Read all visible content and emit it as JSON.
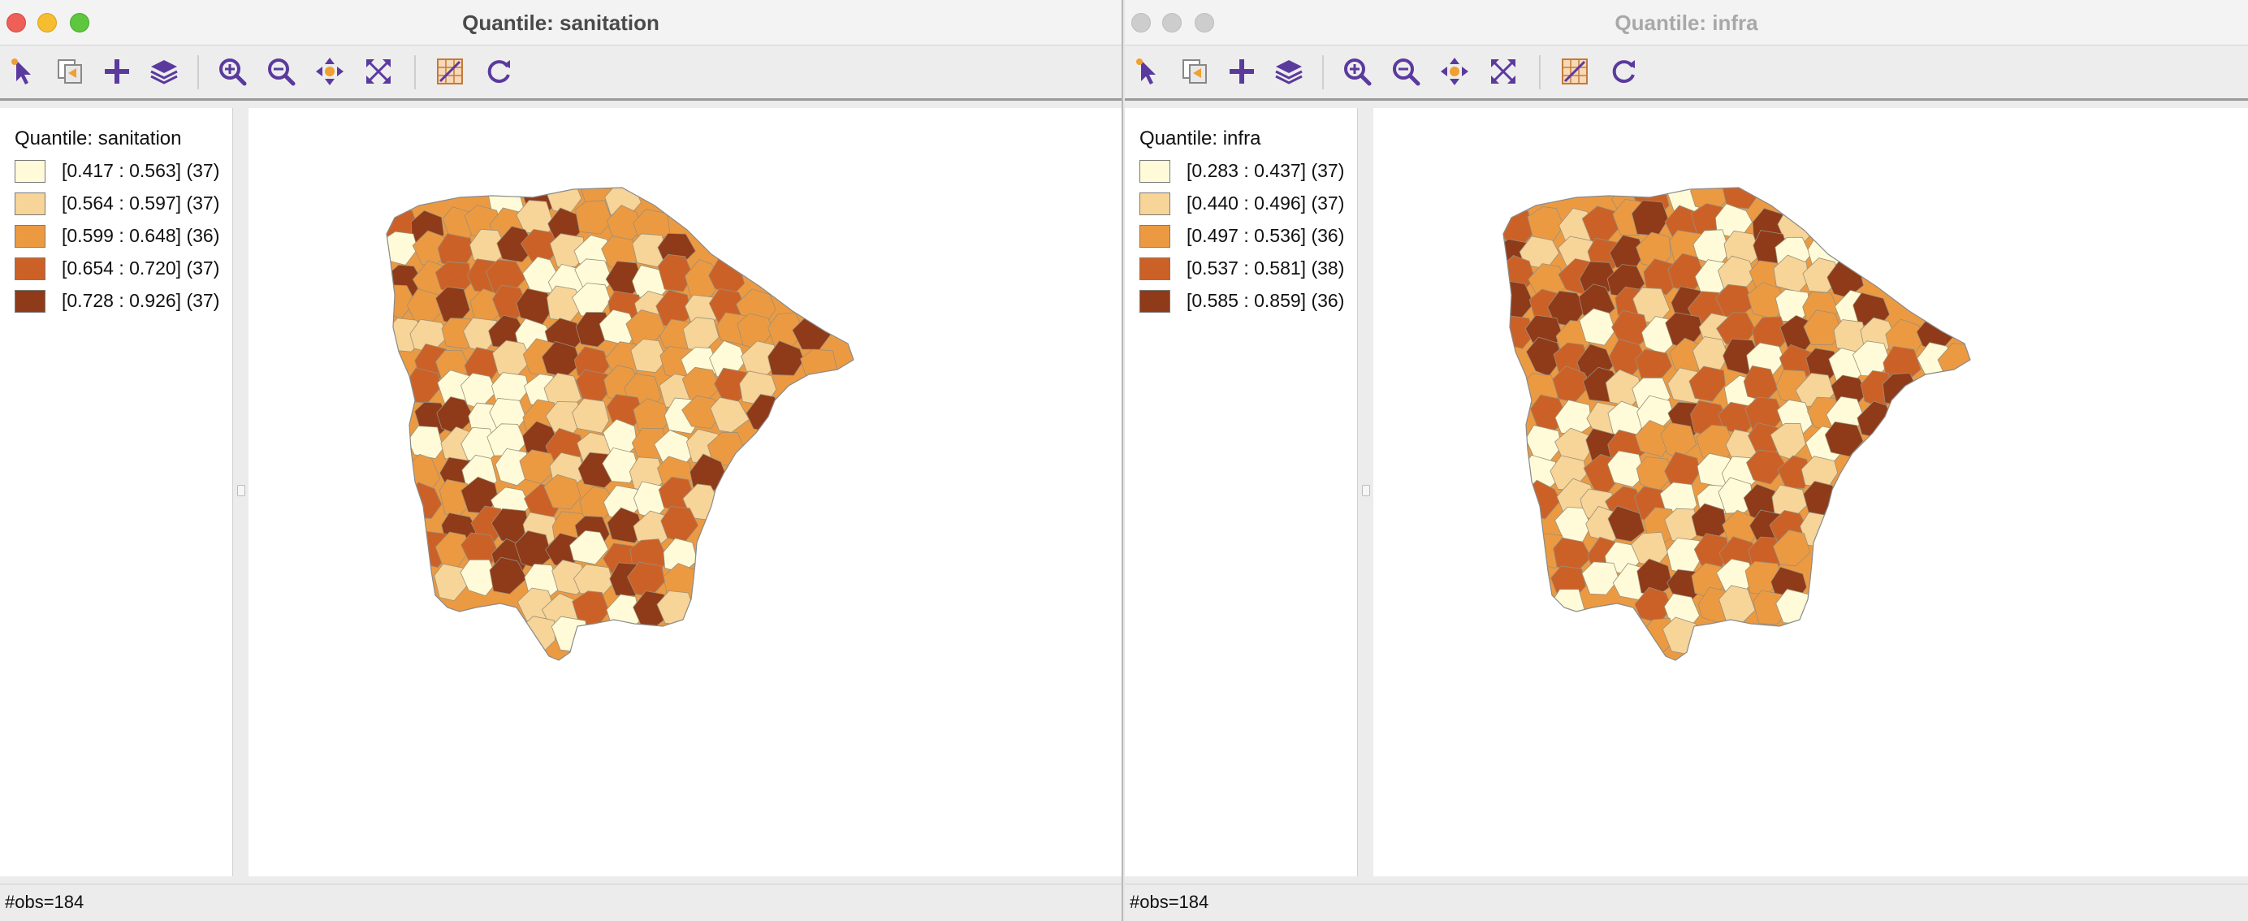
{
  "left_window": {
    "title": "Quantile: sanitation",
    "legend": {
      "title": "Quantile: sanitation",
      "items": [
        {
          "label": "[0.417 : 0.563] (37)",
          "color": "#fffbd8"
        },
        {
          "label": "[0.564 : 0.597] (37)",
          "color": "#f7d497"
        },
        {
          "label": "[0.599 : 0.648] (36)",
          "color": "#ec9a41"
        },
        {
          "label": "[0.654 : 0.720] (37)",
          "color": "#cc6127"
        },
        {
          "label": "[0.728 : 0.926] (37)",
          "color": "#8f3a18"
        }
      ]
    },
    "status": "#obs=184"
  },
  "right_window": {
    "title": "Quantile: infra",
    "legend": {
      "title": "Quantile: infra",
      "items": [
        {
          "label": "[0.283 : 0.437] (37)",
          "color": "#fffbd8"
        },
        {
          "label": "[0.440 : 0.496] (37)",
          "color": "#f7d497"
        },
        {
          "label": "[0.497 : 0.536] (36)",
          "color": "#ec9a41"
        },
        {
          "label": "[0.537 : 0.581] (38)",
          "color": "#cc6127"
        },
        {
          "label": "[0.585 : 0.859] (36)",
          "color": "#8f3a18"
        }
      ]
    },
    "status": "#obs=184"
  },
  "toolbar_icons": [
    "select-arrow-icon",
    "select-copy-icon",
    "add-plus-icon",
    "layers-icon",
    "zoom-in-icon",
    "zoom-out-icon",
    "pan-icon",
    "full-extent-icon",
    "map-settings-icon",
    "refresh-icon"
  ],
  "colors": {
    "icon_purple": "#5b3a9e",
    "icon_orange": "#f0a030",
    "close": "#ee5f57",
    "minimize": "#f5bd2f",
    "zoom": "#5fc63f",
    "inactive": "#cdcdcd"
  }
}
